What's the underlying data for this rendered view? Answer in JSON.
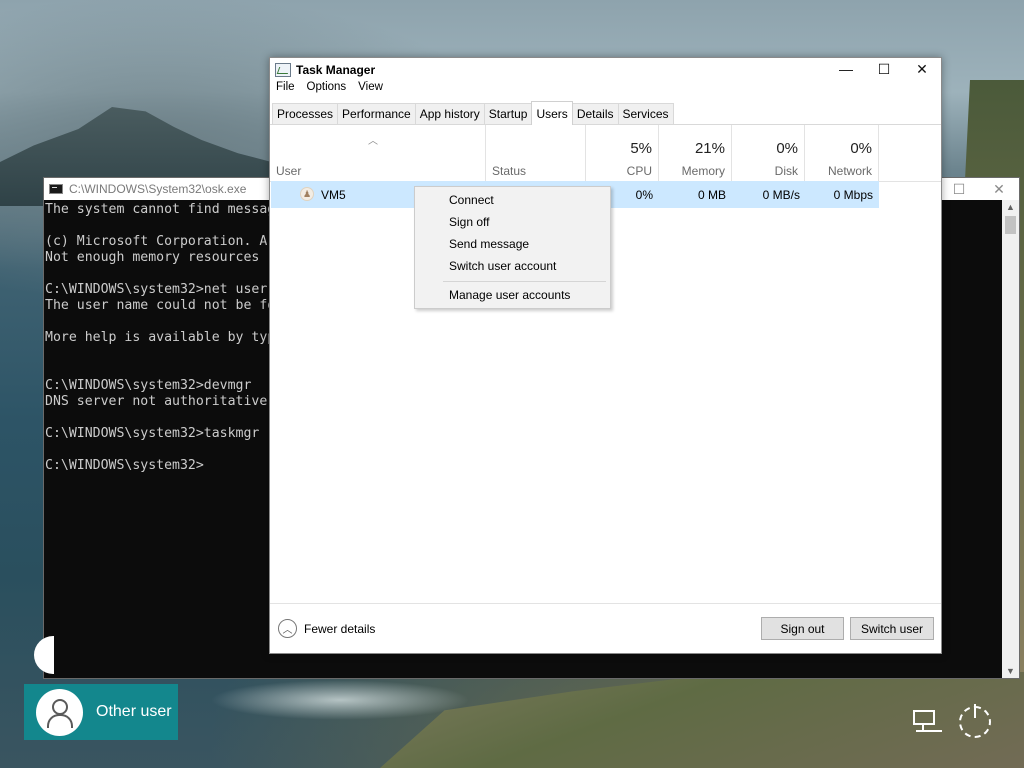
{
  "console": {
    "title": "C:\\WINDOWS\\System32\\osk.exe",
    "lines": "The system cannot find messag\n\n(c) Microsoft Corporation. A\nNot enough memory resources \n\nC:\\WINDOWS\\system32>net user\nThe user name could not be fo\n\nMore help is available by typ\n\n\nC:\\WINDOWS\\system32>devmgr\nDNS server not authoritative\n\nC:\\WINDOWS\\system32>taskmgr\n\nC:\\WINDOWS\\system32>",
    "controls": {
      "maximize": "☐",
      "close": "✕"
    }
  },
  "taskmgr": {
    "title": "Task Manager",
    "controls": {
      "minimize": "—",
      "maximize": "☐",
      "close": "✕"
    },
    "menu": [
      "File",
      "Options",
      "View"
    ],
    "tabs": [
      "Processes",
      "Performance",
      "App history",
      "Startup",
      "Users",
      "Details",
      "Services"
    ],
    "active_tab": "Users",
    "columns": {
      "user": "User",
      "status": "Status",
      "cpu": {
        "pct": "5%",
        "label": "CPU"
      },
      "memory": {
        "pct": "21%",
        "label": "Memory"
      },
      "disk": {
        "pct": "0%",
        "label": "Disk"
      },
      "network": {
        "pct": "0%",
        "label": "Network"
      }
    },
    "row": {
      "user": "VM5",
      "cpu": "0%",
      "memory": "0 MB",
      "disk": "0 MB/s",
      "network": "0 Mbps"
    },
    "context_menu": [
      "Connect",
      "Sign off",
      "Send message",
      "Switch user account",
      "Manage user accounts"
    ],
    "footer": {
      "fewer_details": "Fewer details",
      "sign_out": "Sign out",
      "switch_user": "Switch user"
    }
  },
  "lockscreen": {
    "other_user": "Other user"
  }
}
